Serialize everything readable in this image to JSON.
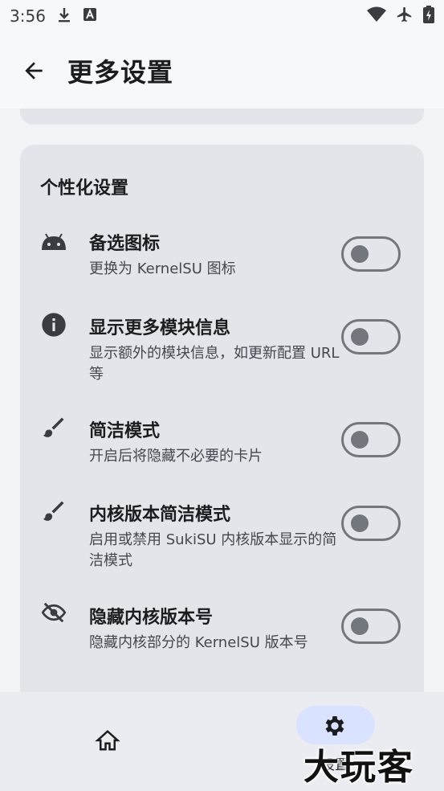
{
  "status_bar": {
    "time": "3:56",
    "left_icons": [
      "download-icon",
      "a-notification-icon"
    ],
    "right_icons": [
      "wifi-icon",
      "airplane-icon",
      "battery-icon"
    ]
  },
  "app_bar": {
    "back_icon": "arrow-left-icon",
    "title": "更多设置"
  },
  "section": {
    "title": "个性化设置",
    "items": [
      {
        "icon": "android-icon",
        "title": "备选图标",
        "subtitle": "更换为 KernelSU 图标",
        "enabled": false
      },
      {
        "icon": "info-icon",
        "title": "显示更多模块信息",
        "subtitle": "显示额外的模块信息，如更新配置 URL 等",
        "enabled": false
      },
      {
        "icon": "brush-icon",
        "title": "简洁模式",
        "subtitle": "开启后将隐藏不必要的卡片",
        "enabled": false
      },
      {
        "icon": "brush-icon",
        "title": "内核版本简洁模式",
        "subtitle": "启用或禁用 SukiSU 内核版本显示的简洁模式",
        "enabled": false
      },
      {
        "icon": "eye-off-icon",
        "title": "隐藏内核版本号",
        "subtitle": "隐藏内核部分的 KernelSU 版本号",
        "enabled": false
      }
    ]
  },
  "bottom_nav": {
    "items": [
      {
        "icon": "home-icon",
        "label": "",
        "selected": false
      },
      {
        "icon": "gear-icon",
        "label": "设置",
        "selected": true
      }
    ]
  },
  "watermark": "大玩客",
  "colors": {
    "background": "#f7f8fb",
    "card": "#e4e5ea",
    "nav_pill": "#d9e2ff",
    "toggle_off": "#74767e"
  }
}
